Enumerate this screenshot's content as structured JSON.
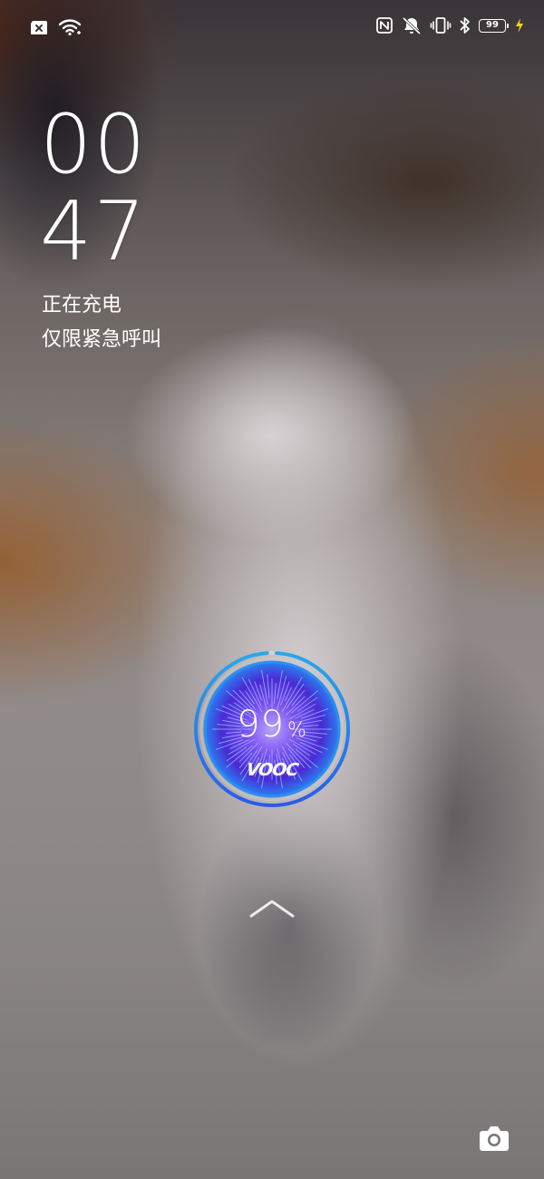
{
  "status_bar": {
    "left_icons": [
      "sim-error-icon",
      "wifi-icon"
    ],
    "right_icons": [
      "nfc-icon",
      "mute-icon",
      "vibrate-icon",
      "bluetooth-icon",
      "battery-icon",
      "charging-bolt-icon"
    ],
    "battery_level": "99"
  },
  "clock": {
    "hour": "00",
    "minute": "47"
  },
  "lockscreen": {
    "status_text": "正在充电",
    "carrier_text": "仅限紧急呼叫"
  },
  "charging": {
    "percent": "99",
    "percent_sign": "%",
    "brand": "VOOC",
    "level_fraction": 0.99
  },
  "colors": {
    "ring_blue": "#2a5ce8",
    "ring_cyan": "#2aa8e8",
    "core_purple": "#5a2bd6",
    "bolt_yellow": "#f2d21b"
  },
  "actions": {
    "unlock_icon": "chevron-up-icon",
    "camera_icon": "camera-icon"
  }
}
